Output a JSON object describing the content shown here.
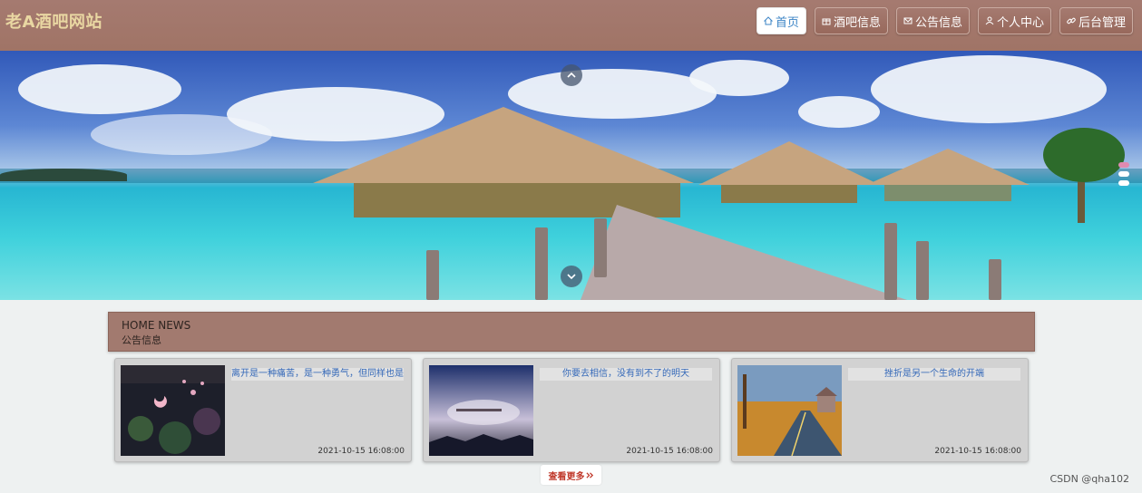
{
  "header": {
    "logo": "老A酒吧网站",
    "nav": [
      {
        "label": "首页",
        "icon": "home-icon",
        "active": true
      },
      {
        "label": "酒吧信息",
        "icon": "gift-icon",
        "active": false
      },
      {
        "label": "公告信息",
        "icon": "mail-icon",
        "active": false
      },
      {
        "label": "个人中心",
        "icon": "user-icon",
        "active": false
      },
      {
        "label": "后台管理",
        "icon": "link-icon",
        "active": false
      }
    ]
  },
  "banner": {
    "prev_icon": "chevron-up-icon",
    "next_icon": "chevron-down-icon",
    "indicator_count": 3,
    "active_indicator": 1
  },
  "news": {
    "heading_en": "HOME NEWS",
    "heading_cn": "公告信息",
    "items": [
      {
        "title": "离开是一种痛苦，是一种勇气，但同样也是...",
        "date": "2021-10-15 16:08:00"
      },
      {
        "title": "你要去相信，没有到不了的明天",
        "date": "2021-10-15 16:08:00"
      },
      {
        "title": "挫折是另一个生命的开端",
        "date": "2021-10-15 16:08:00"
      }
    ],
    "more_label": "查看更多",
    "more_icon": "double-chevron-right-icon"
  },
  "watermark": "CSDN @qha102",
  "colors": {
    "header_bg": "#a57a70",
    "logo": "#e9d7a2",
    "active_nav_text": "#3d85c6",
    "news_header_bg": "#a27a6f",
    "card_title": "#3468b8",
    "more_text": "#c0392b"
  }
}
